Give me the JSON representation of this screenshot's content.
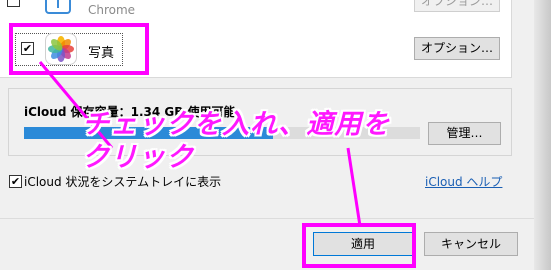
{
  "services": {
    "chrome": {
      "label": "Chrome",
      "options_label": "オプション…",
      "checked": false
    },
    "photos": {
      "label": "写真",
      "options_label": "オプション…",
      "checked": true,
      "check_mark": "✔"
    }
  },
  "storage": {
    "label": "iCloud 保存容量：1.34 GB 使用可能",
    "manage_label": "管理…",
    "used_fraction": 0.63,
    "bar_color": "#2b8ad8"
  },
  "tray": {
    "check_mark": "✔",
    "label": "iCloud 状況をシステムトレイに表示",
    "help_link": "iCloud ヘルプ"
  },
  "buttons": {
    "apply": "適用",
    "cancel": "キャンセル"
  },
  "annotation": {
    "line1": "チェックを入れ、適用を",
    "line2": "クリック",
    "color": "#ff00ff"
  },
  "icons": {
    "chrome": "chrome-app-icon",
    "photos": "photos-pinwheel-icon"
  }
}
